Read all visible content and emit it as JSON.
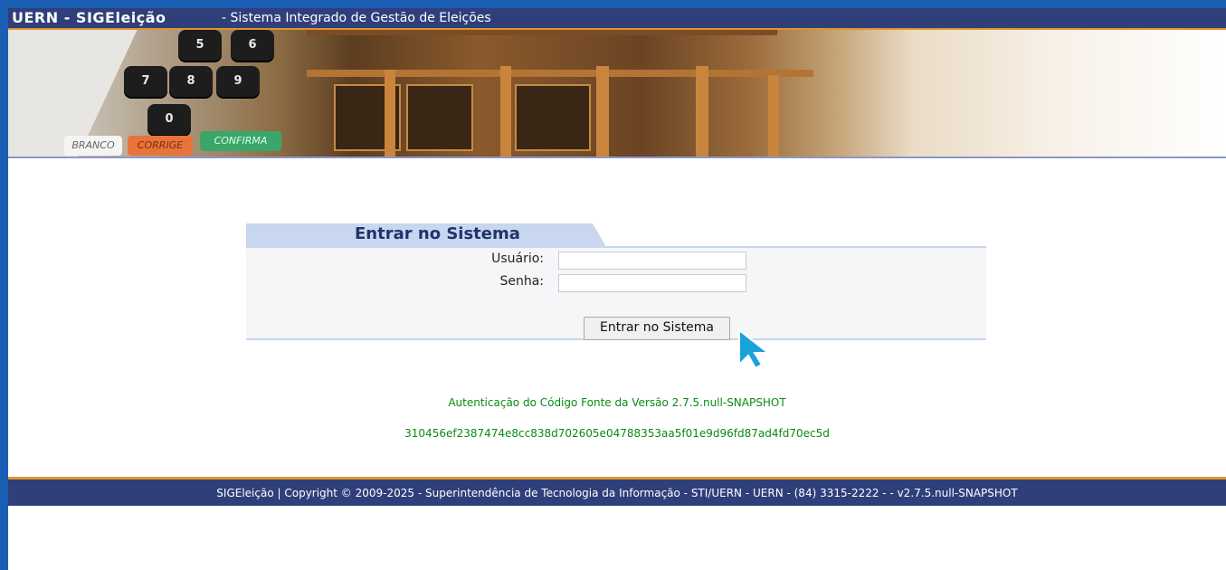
{
  "header": {
    "app_name": "UERN - SIGEleição",
    "subtitle": "- Sistema Integrado de Gestão de Eleições"
  },
  "banner": {
    "keys": [
      "5",
      "6",
      "7",
      "8",
      "9",
      "0"
    ],
    "buttons": [
      "BRANCO",
      "CORRIGE",
      "CONFIRMA"
    ]
  },
  "login": {
    "title": "Entrar no Sistema",
    "user_label": "Usuário:",
    "password_label": "Senha:",
    "user_value": "",
    "password_value": "",
    "submit_label": "Entrar no Sistema"
  },
  "auth": {
    "version_line": "Autenticação do Código Fonte da Versão 2.7.5.null-SNAPSHOT",
    "hash": "310456ef2387474e8cc838d702605e04788353aa5f01e9d96fd87ad4fd70ec5d"
  },
  "footer": {
    "text": "SIGEleição | Copyright © 2009-2025 - Superintendência de Tecnologia da Informação - STI/UERN - UERN - (84) 3315-2222 - - v2.7.5.null-SNAPSHOT"
  },
  "colors": {
    "frame": "#1a5fb4",
    "bar": "#2f3f7a",
    "accent": "#e0932e",
    "auth_text": "#0a8a12",
    "tab": "#c8d6f0"
  }
}
